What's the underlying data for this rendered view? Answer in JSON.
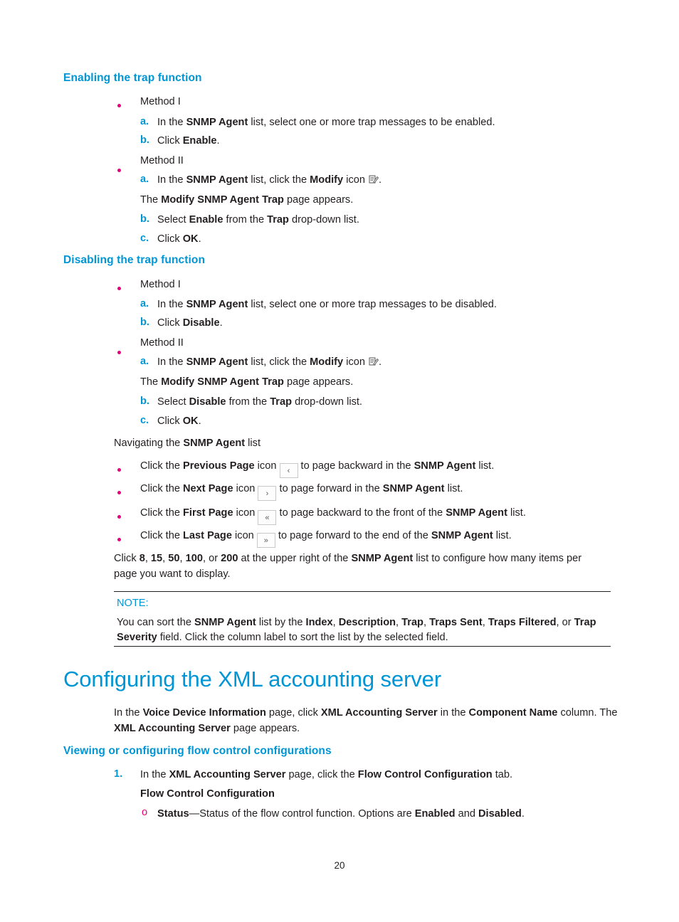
{
  "sections": {
    "enabling": {
      "heading": "Enabling the trap function",
      "method1": "Method I",
      "m1a_pre": "In the ",
      "m1a_b1": "SNMP Agent",
      "m1a_mid": " list, select one or more trap messages to be enabled.",
      "m1b_pre": "Click ",
      "m1b_b1": "Enable",
      "m1b_post": ".",
      "method2": "Method II",
      "m2a_pre": "In the ",
      "m2a_b1": "SNMP Agent",
      "m2a_mid": " list, click the ",
      "m2a_b2": "Modify",
      "m2a_post": " icon",
      "m2a_end": ".",
      "m2_note_pre": "The ",
      "m2_note_b": "Modify SNMP Agent Trap",
      "m2_note_post": " page appears.",
      "m2b_pre": "Select ",
      "m2b_b1": "Enable",
      "m2b_mid": " from the ",
      "m2b_b2": "Trap",
      "m2b_post": " drop-down list.",
      "m2c_pre": "Click ",
      "m2c_b1": "OK",
      "m2c_post": "."
    },
    "disabling": {
      "heading": "Disabling the trap function",
      "method1": "Method I",
      "m1a_pre": "In the ",
      "m1a_b1": "SNMP Agent",
      "m1a_mid": " list, select one or more trap messages to be disabled.",
      "m1b_pre": "Click ",
      "m1b_b1": "Disable",
      "m1b_post": ".",
      "method2": "Method II",
      "m2a_pre": "In the ",
      "m2a_b1": "SNMP Agent",
      "m2a_mid": " list, click the ",
      "m2a_b2": "Modify",
      "m2a_post": " icon",
      "m2a_end": ".",
      "m2_note_pre": "The ",
      "m2_note_b": "Modify SNMP Agent Trap",
      "m2_note_post": " page appears.",
      "m2b_pre": "Select ",
      "m2b_b1": "Disable",
      "m2b_mid": " from the ",
      "m2b_b2": "Trap",
      "m2b_post": " drop-down list.",
      "m2c_pre": "Click ",
      "m2c_b1": "OK",
      "m2c_post": "."
    },
    "navigating": {
      "intro_pre": "Navigating the ",
      "intro_b": "SNMP Agent",
      "intro_post": " list",
      "prev_pre": "Click the ",
      "prev_b": "Previous Page",
      "prev_mid": " icon",
      "prev_glyph": "‹",
      "prev_post": " to page backward in the ",
      "prev_b2": "SNMP Agent",
      "prev_end": " list.",
      "next_pre": "Click the ",
      "next_b": "Next Page",
      "next_mid": " icon",
      "next_glyph": "›",
      "next_post": " to page forward in the ",
      "next_b2": "SNMP Agent",
      "next_end": " list.",
      "first_pre": "Click the ",
      "first_b": "First Page",
      "first_mid": " icon",
      "first_glyph": "«",
      "first_post": " to page backward to the front of the ",
      "first_b2": "SNMP Agent",
      "first_end": " list.",
      "last_pre": "Click the ",
      "last_b": "Last Page",
      "last_mid": " icon",
      "last_glyph": "»",
      "last_post": " to page forward to the end of the ",
      "last_b2": "SNMP Agent",
      "last_end": " list.",
      "counts_pre": "Click ",
      "c1": "8",
      "sep1": ", ",
      "c2": "15",
      "sep2": ", ",
      "c3": "50",
      "sep3": ", ",
      "c4": "100",
      "sep4": ", or ",
      "c5": "200",
      "counts_mid": " at the upper right of the ",
      "counts_b": "SNMP Agent",
      "counts_post": " list to configure how many items per",
      "counts_line2": "page you want to display."
    },
    "note": {
      "label": "NOTE:",
      "l1_pre": "You can sort the ",
      "l1_b1": "SNMP Agent",
      "l1_mid": " list by the ",
      "l1_b2": "Index",
      "l1_s1": ", ",
      "l1_b3": "Description",
      "l1_s2": ", ",
      "l1_b4": "Trap",
      "l1_s3": ", ",
      "l1_b5": "Traps Sent",
      "l1_s4": ", ",
      "l1_b6": "Traps Filtered",
      "l1_s5": ", or ",
      "l1_b7": "Trap",
      "l2_b1": "Severity",
      "l2_post": " field. Click the column label to sort the list by the selected field."
    },
    "chapter": {
      "title": "Configuring the XML accounting server",
      "intro_pre": "In the ",
      "intro_b1": "Voice Device Information",
      "intro_mid": " page, click ",
      "intro_b2": "XML Accounting Server",
      "intro_mid2": " in the ",
      "intro_b3": "Component Name",
      "intro_post": " column. The",
      "intro_l2_b": "XML Accounting Server",
      "intro_l2_post": " page appears."
    },
    "viewing": {
      "heading": "Viewing or configuring flow control configurations",
      "step1_num": "1.",
      "step1_pre": "In the ",
      "step1_b1": "XML Accounting Server",
      "step1_mid": " page, click the ",
      "step1_b2": "Flow Control Configuration",
      "step1_post": " tab.",
      "sub_head": "Flow Control Configuration",
      "opt_marker": "o",
      "opt_b": "Status",
      "opt_mid": "—Status of the flow control function. Options are ",
      "opt_b2": "Enabled",
      "opt_and": " and ",
      "opt_b3": "Disabled",
      "opt_end": "."
    }
  },
  "footer": {
    "page_number": "20"
  },
  "markers": {
    "a": "a.",
    "b": "b.",
    "c": "c."
  },
  "colors": {
    "heading_blue": "#0096d6",
    "marker_magenta": "#e2007a",
    "body_text": "#231f20"
  }
}
